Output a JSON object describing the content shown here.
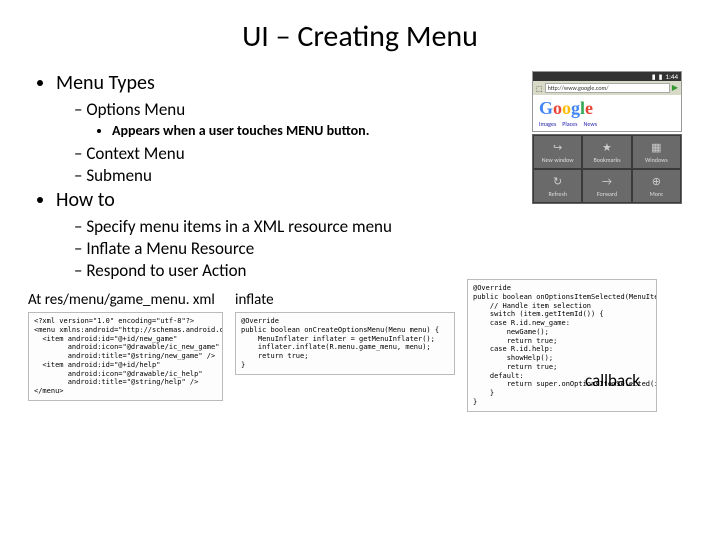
{
  "title": "UI – Creating Menu",
  "bullets": {
    "menu_types": "Menu Types",
    "options_menu": "Options Menu",
    "options_desc": "Appears when a user touches MENU button.",
    "context_menu": "Context Menu",
    "submenu": "Submenu",
    "how_to": "How to",
    "howto_1": "Specify menu items in a XML resource menu",
    "howto_2": "Inflate a Menu Resource",
    "howto_3": "Respond to user Action"
  },
  "callback_label": "callback",
  "phone": {
    "time": "1:44",
    "url": "http://www.google.com/",
    "links": {
      "a": "Images",
      "b": "Places",
      "c": "News"
    },
    "menu": [
      {
        "icon": "↪",
        "label": "New window"
      },
      {
        "icon": "★",
        "label": "Bookmarks"
      },
      {
        "icon": "▦",
        "label": "Windows"
      },
      {
        "icon": "↻",
        "label": "Refresh"
      },
      {
        "icon": "→",
        "label": "Forward"
      },
      {
        "icon": "⊕",
        "label": "More"
      }
    ]
  },
  "code_labels": {
    "xml_path": "At res/menu/game_menu. xml",
    "inflate": "inflate"
  },
  "code": {
    "xml": "<?xml version=\"1.0\" encoding=\"utf-8\"?>\n<menu xmlns:android=\"http://schemas.android.com/apk/res/android\">\n  <item android:id=\"@+id/new_game\"\n        android:icon=\"@drawable/ic_new_game\"\n        android:title=\"@string/new_game\" />\n  <item android:id=\"@+id/help\"\n        android:icon=\"@drawable/ic_help\"\n        android:title=\"@string/help\" />\n</menu>",
    "inflate": "@Override\npublic boolean onCreateOptionsMenu(Menu menu) {\n    MenuInflater inflater = getMenuInflater();\n    inflater.inflate(R.menu.game_menu, menu);\n    return true;\n}",
    "callback": "@Override\npublic boolean onOptionsItemSelected(MenuItem item) {\n    // Handle item selection\n    switch (item.getItemId()) {\n    case R.id.new_game:\n        newGame();\n        return true;\n    case R.id.help:\n        showHelp();\n        return true;\n    default:\n        return super.onOptionsItemSelected(item);\n    }\n}"
  }
}
